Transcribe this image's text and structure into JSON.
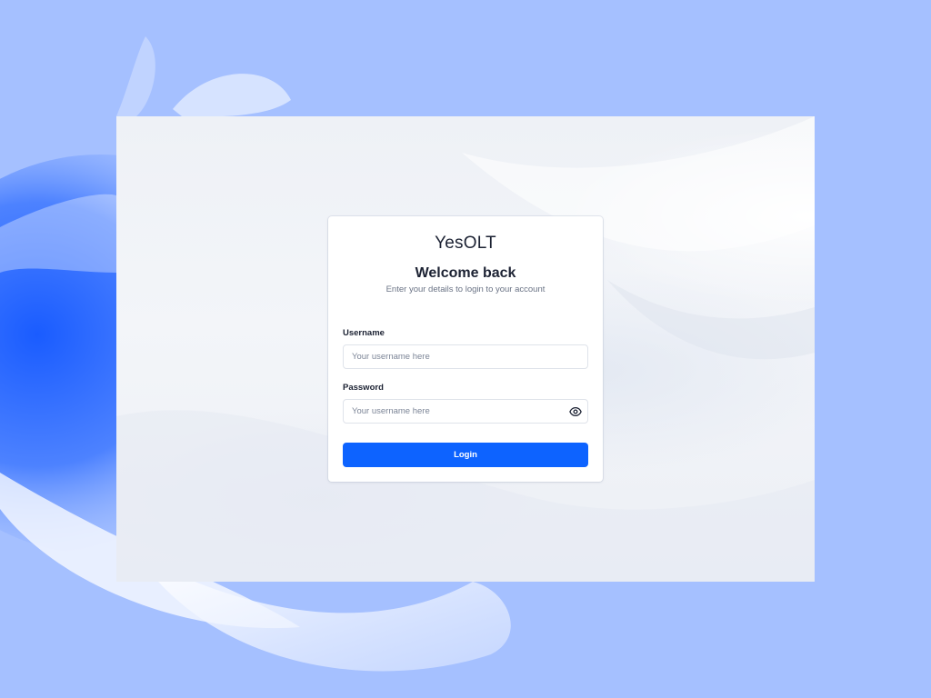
{
  "login": {
    "brand": "YesOLT",
    "heading": "Welcome back",
    "subtitle": "Enter your details to login to your account",
    "username_label": "Username",
    "username_placeholder": "Your username here",
    "username_value": "",
    "password_label": "Password",
    "password_placeholder": "Your username here",
    "password_value": "",
    "password_toggle_icon": "eye-icon",
    "submit_label": "Login"
  },
  "theme": {
    "desktop_background": "#a5c0ff",
    "wallpaper_accent": "#1a5cff",
    "window_background": "#eef1f6",
    "card_background": "#ffffff",
    "primary_button": "#0d63ff",
    "text_primary": "#1c2233",
    "text_muted": "#6a7385"
  }
}
